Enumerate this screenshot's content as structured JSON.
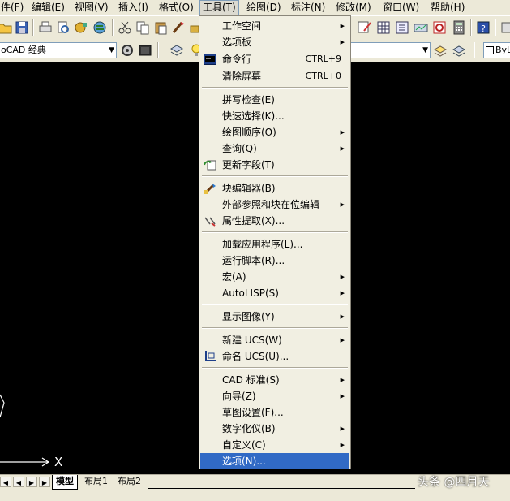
{
  "menubar": {
    "items": [
      {
        "id": "file",
        "label": "件(F)"
      },
      {
        "id": "edit",
        "label": "编辑(E)"
      },
      {
        "id": "view",
        "label": "视图(V)"
      },
      {
        "id": "insert",
        "label": "插入(I)"
      },
      {
        "id": "format",
        "label": "格式(O)"
      },
      {
        "id": "tools",
        "label": "工具(T)"
      },
      {
        "id": "draw",
        "label": "绘图(D)"
      },
      {
        "id": "dimension",
        "label": "标注(N)"
      },
      {
        "id": "modify",
        "label": "修改(M)"
      },
      {
        "id": "window",
        "label": "窗口(W)"
      },
      {
        "id": "help",
        "label": "帮助(H)"
      }
    ]
  },
  "toolbar": {
    "workspace_value": "oCAD 经典",
    "bylayer_value": "ByL"
  },
  "tools_menu": {
    "items": [
      {
        "label": "工作空间",
        "shortcut": "",
        "submenu": true,
        "icon": ""
      },
      {
        "label": "选项板",
        "shortcut": "",
        "submenu": true,
        "icon": ""
      },
      {
        "label": "命令行",
        "shortcut": "CTRL+9",
        "submenu": false,
        "icon": "command-line-icon"
      },
      {
        "label": "清除屏幕",
        "shortcut": "CTRL+0",
        "submenu": false,
        "icon": ""
      },
      {
        "label": "拼写检查(E)",
        "shortcut": "",
        "submenu": false,
        "icon": ""
      },
      {
        "label": "快速选择(K)...",
        "shortcut": "",
        "submenu": false,
        "icon": ""
      },
      {
        "label": "绘图顺序(O)",
        "shortcut": "",
        "submenu": true,
        "icon": ""
      },
      {
        "label": "查询(Q)",
        "shortcut": "",
        "submenu": true,
        "icon": ""
      },
      {
        "label": "更新字段(T)",
        "shortcut": "",
        "submenu": false,
        "icon": "update-field-icon"
      },
      {
        "label": "块编辑器(B)",
        "shortcut": "",
        "submenu": false,
        "icon": "block-editor-icon"
      },
      {
        "label": "外部参照和块在位编辑",
        "shortcut": "",
        "submenu": true,
        "icon": ""
      },
      {
        "label": "属性提取(X)...",
        "shortcut": "",
        "submenu": false,
        "icon": "attribute-extract-icon"
      },
      {
        "label": "加载应用程序(L)...",
        "shortcut": "",
        "submenu": false,
        "icon": ""
      },
      {
        "label": "运行脚本(R)...",
        "shortcut": "",
        "submenu": false,
        "icon": ""
      },
      {
        "label": "宏(A)",
        "shortcut": "",
        "submenu": true,
        "icon": ""
      },
      {
        "label": "AutoLISP(S)",
        "shortcut": "",
        "submenu": true,
        "icon": ""
      },
      {
        "label": "显示图像(Y)",
        "shortcut": "",
        "submenu": true,
        "icon": ""
      },
      {
        "label": "新建 UCS(W)",
        "shortcut": "",
        "submenu": true,
        "icon": ""
      },
      {
        "label": "命名 UCS(U)...",
        "shortcut": "",
        "submenu": false,
        "icon": "named-ucs-icon"
      },
      {
        "label": "CAD 标准(S)",
        "shortcut": "",
        "submenu": true,
        "icon": ""
      },
      {
        "label": "向导(Z)",
        "shortcut": "",
        "submenu": true,
        "icon": ""
      },
      {
        "label": "草图设置(F)...",
        "shortcut": "",
        "submenu": false,
        "icon": ""
      },
      {
        "label": "数字化仪(B)",
        "shortcut": "",
        "submenu": true,
        "icon": ""
      },
      {
        "label": "自定义(C)",
        "shortcut": "",
        "submenu": true,
        "icon": ""
      },
      {
        "label": "选项(N)...",
        "shortcut": "",
        "submenu": false,
        "icon": ""
      }
    ]
  },
  "canvas": {
    "axis_x_label": "X"
  },
  "layout_tabs": {
    "items": [
      {
        "label": "模型",
        "active": true
      },
      {
        "label": "布局1",
        "active": false
      },
      {
        "label": "布局2",
        "active": false
      }
    ]
  },
  "watermark": "头条 @四月天",
  "colors": {
    "highlight": "#316ac5",
    "menu_bg": "#f1efe2",
    "canvas_bg": "#000000"
  }
}
